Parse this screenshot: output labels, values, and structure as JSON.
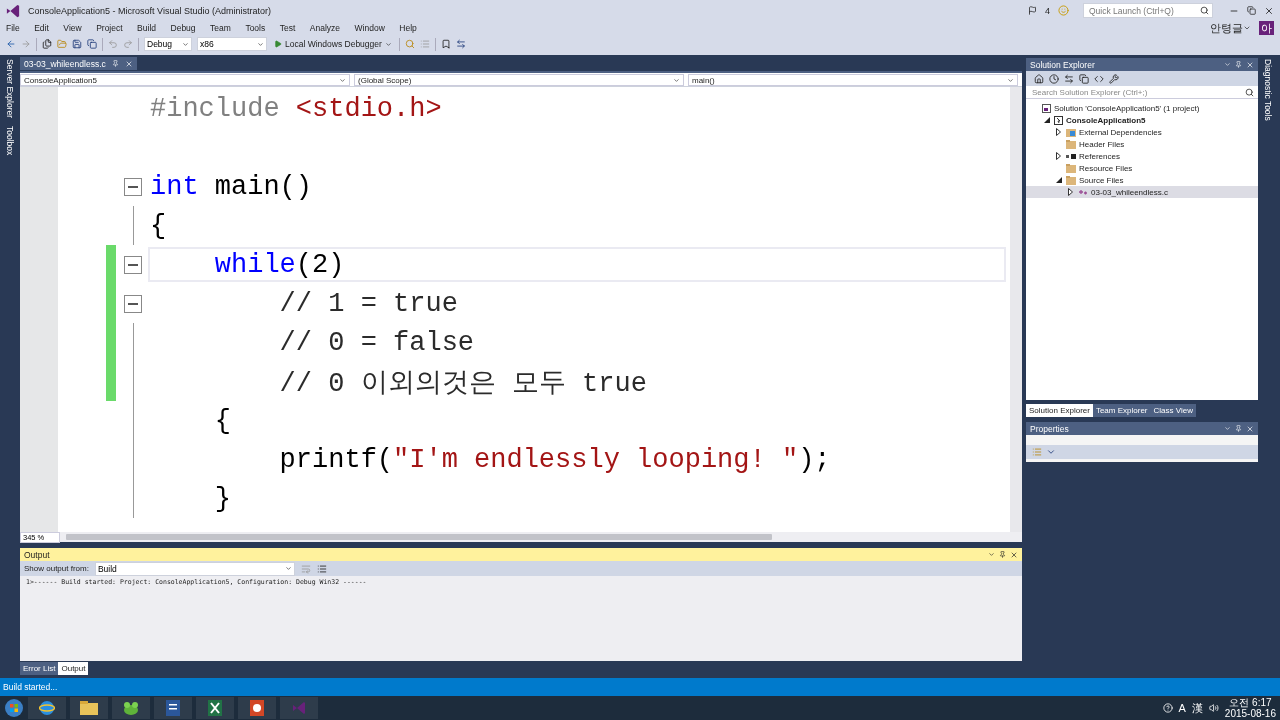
{
  "window": {
    "title": "ConsoleApplication5 - Microsoft Visual Studio (Administrator)",
    "notifications": "4",
    "quick_launch": {
      "placeholder": "Quick Launch (Ctrl+Q)"
    },
    "user": "안텽글",
    "avatar": "아"
  },
  "menu": [
    "File",
    "Edit",
    "View",
    "Project",
    "Build",
    "Debug",
    "Team",
    "Tools",
    "Test",
    "Analyze",
    "Window",
    "Help"
  ],
  "toolbar": {
    "configuration": "Debug",
    "platform": "x86",
    "start": "Local Windows Debugger"
  },
  "side_tabs_left": [
    "Server Explorer",
    "Toolbox"
  ],
  "side_tabs_right": [
    "Diagnostic Tools"
  ],
  "editor": {
    "tab": "03-03_whileendless.c",
    "project": "ConsoleApplication5",
    "scope": "(Global Scope)",
    "member": "main()",
    "zoom": "345 %",
    "lines": [
      {
        "tokens": [
          {
            "kind": "preproc",
            "text": "#include "
          },
          {
            "kind": "string",
            "text": "<stdio.h>"
          }
        ],
        "changed": false,
        "current": false,
        "collapsible": false
      },
      {
        "changed": false,
        "current": false,
        "collapsible": false
      },
      {
        "tokens": [
          {
            "kind": "keyword",
            "text": "int"
          },
          {
            "kind": "plain",
            "text": " main()"
          }
        ],
        "changed": false,
        "current": false,
        "collapsible": true
      },
      {
        "tokens": [
          {
            "kind": "plain",
            "text": "{"
          }
        ],
        "changed": false,
        "current": false,
        "collapsible": false
      },
      {
        "tokens": [
          {
            "kind": "keyword",
            "text": "    while"
          },
          {
            "kind": "plain",
            "text": "(2)"
          }
        ],
        "changed": true,
        "current": true,
        "collapsible": true
      },
      {
        "tokens": [
          {
            "kind": "comment",
            "text": "        // 1 = true"
          }
        ],
        "changed": true,
        "current": false,
        "collapsible": true
      },
      {
        "tokens": [
          {
            "kind": "comment",
            "text": "        // 0 = false"
          }
        ],
        "changed": true,
        "current": false,
        "collapsible": false
      },
      {
        "tokens": [
          {
            "kind": "comment",
            "text": "        // 0 이외의것은 모두 true"
          }
        ],
        "changed": true,
        "current": false,
        "collapsible": false
      },
      {
        "tokens": [
          {
            "kind": "plain",
            "text": "    {"
          }
        ],
        "changed": false,
        "current": false,
        "collapsible": false
      },
      {
        "tokens": [
          {
            "kind": "plain",
            "text": "        printf("
          },
          {
            "kind": "string",
            "text": "\"I'm endlessly looping! \""
          },
          {
            "kind": "plain",
            "text": ");"
          }
        ],
        "changed": false,
        "current": false,
        "collapsible": false
      },
      {
        "tokens": [
          {
            "kind": "plain",
            "text": "    }"
          }
        ],
        "changed": false,
        "current": false,
        "collapsible": false
      }
    ]
  },
  "solution_explorer": {
    "title": "Solution Explorer",
    "search": {
      "placeholder": "Search Solution Explorer (Ctrl+;)"
    },
    "tree": [
      {
        "label": "Solution 'ConsoleApplication5' (1 project)",
        "kind": "solution",
        "expandable": false,
        "selected": false,
        "children": [
          {
            "label": "ConsoleApplication5",
            "kind": "project",
            "expandable": true,
            "expanded": true,
            "selected": false,
            "children": [
              {
                "label": "External Dependencies",
                "kind": "dependencies",
                "expandable": true,
                "expanded": false,
                "selected": false
              },
              {
                "label": "Header Files",
                "kind": "folder",
                "expandable": false,
                "selected": false
              },
              {
                "label": "References",
                "kind": "references",
                "expandable": true,
                "expanded": false,
                "selected": false
              },
              {
                "label": "Resource Files",
                "kind": "folder",
                "expandable": false,
                "selected": false
              },
              {
                "label": "Source Files",
                "kind": "folder",
                "expandable": true,
                "expanded": true,
                "selected": false,
                "children": [
                  {
                    "label": "03-03_whileendless.c",
                    "kind": "file",
                    "expandable": true,
                    "expanded": false,
                    "selected": true
                  }
                ]
              }
            ]
          }
        ]
      }
    ],
    "tabs": [
      {
        "label": "Solution Explorer",
        "selected": true
      },
      {
        "label": "Team Explorer",
        "selected": false
      },
      {
        "label": "Class View",
        "selected": false
      }
    ]
  },
  "properties": {
    "title": "Properties"
  },
  "output": {
    "title": "Output",
    "source_label": "Show output from:",
    "source": "Build",
    "lines": [
      "1>------ Build started: Project: ConsoleApplication5, Configuration: Debug Win32 ------"
    ],
    "tabs": [
      {
        "label": "Error List",
        "selected": false
      },
      {
        "label": "Output",
        "selected": true
      }
    ]
  },
  "status_bar": {
    "text": "Build started..."
  },
  "taskbar": {
    "apps": [
      {
        "kind": "ie"
      },
      {
        "kind": "explorer"
      },
      {
        "kind": "frog"
      },
      {
        "kind": "word"
      },
      {
        "kind": "excel"
      },
      {
        "kind": "powerpoint"
      },
      {
        "kind": "studio"
      }
    ],
    "ime": [
      "A",
      "漢"
    ],
    "time": "오전 6:17",
    "date": "2015-08-16"
  }
}
